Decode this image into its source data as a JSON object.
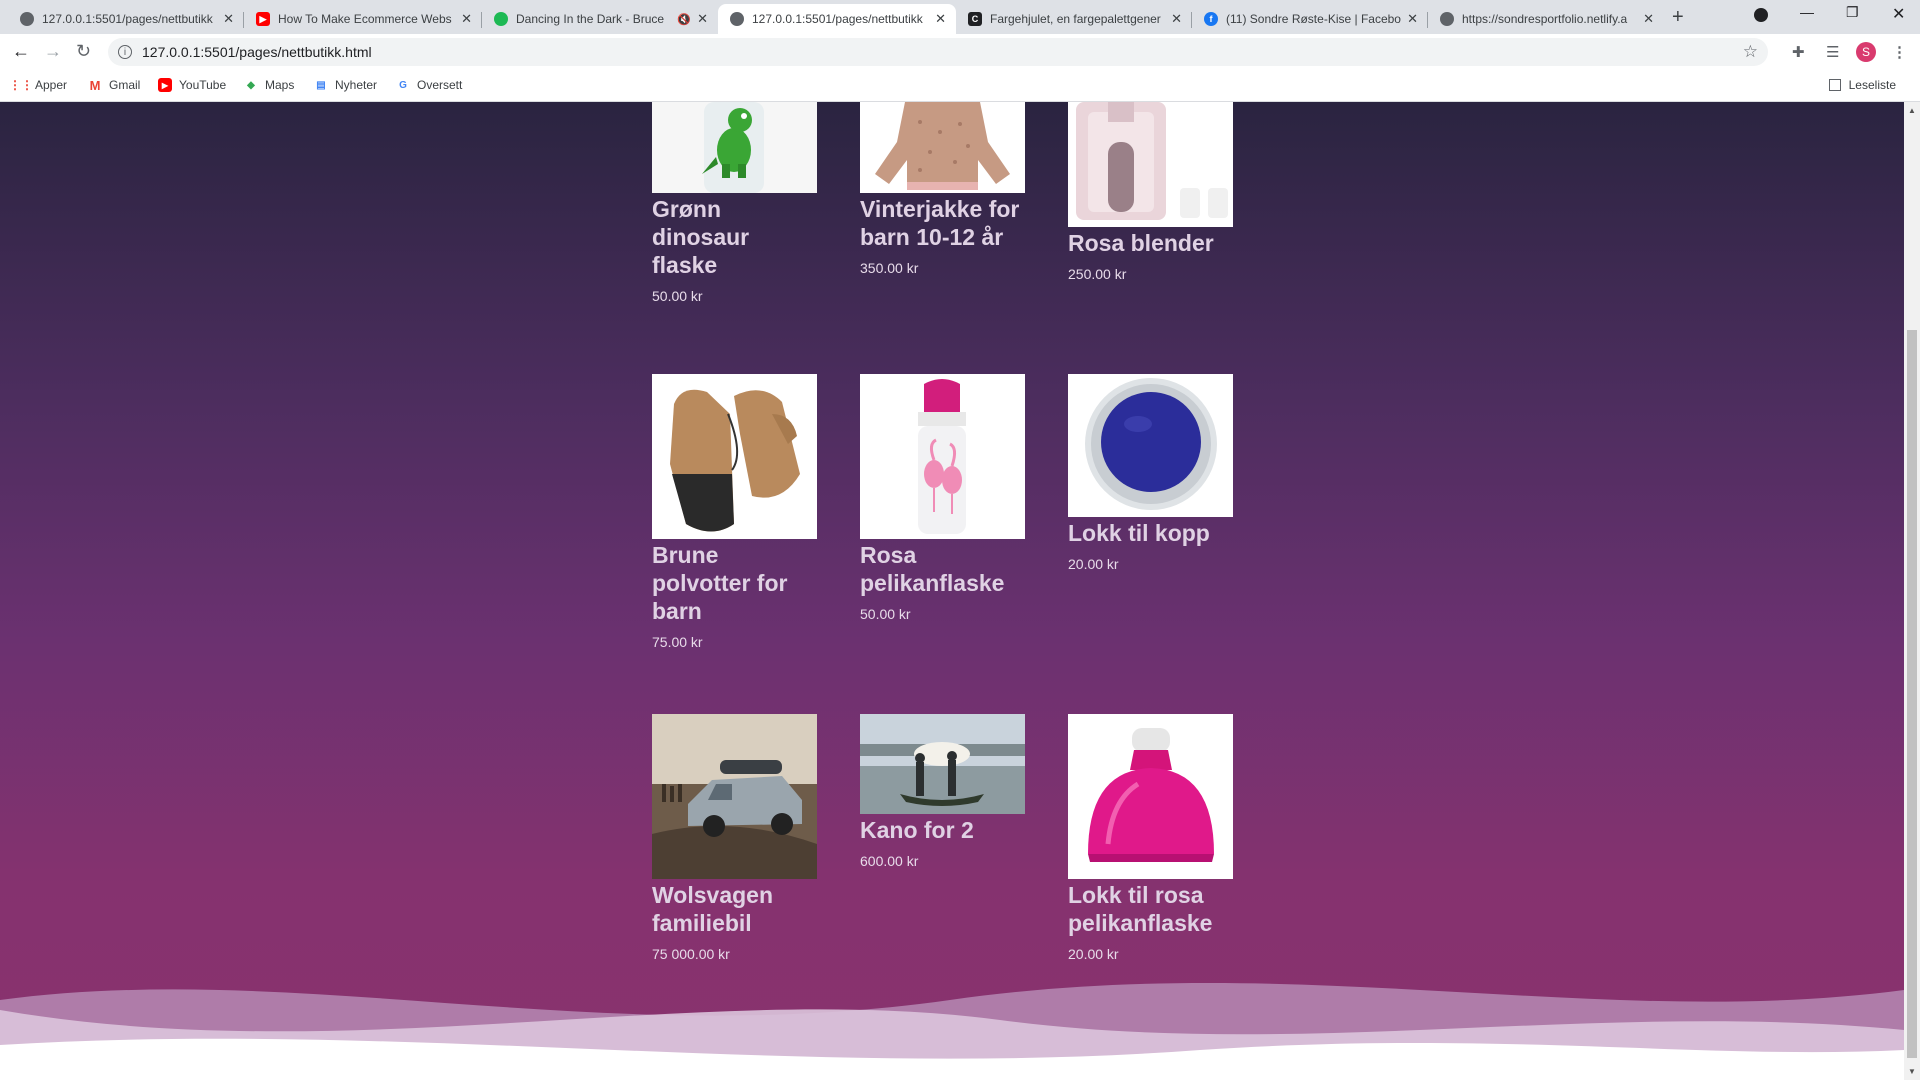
{
  "browser": {
    "tabs": [
      {
        "title": "127.0.0.1:5501/pages/nettbutikk",
        "icon": "globe-icon",
        "active": false
      },
      {
        "title": "How To Make Ecommerce Webs",
        "icon": "youtube-icon",
        "active": false
      },
      {
        "title": "Dancing In the Dark - Bruce",
        "icon": "spotify-icon",
        "active": false,
        "muted": true
      },
      {
        "title": "127.0.0.1:5501/pages/nettbutikk",
        "icon": "globe-icon",
        "active": true
      },
      {
        "title": "Fargehjulet, en fargepalettgener",
        "icon": "canva-icon",
        "active": false
      },
      {
        "title": "(11) Sondre Røste-Kise | Facebo",
        "icon": "facebook-icon",
        "active": false
      },
      {
        "title": "https://sondresportfolio.netlify.a",
        "icon": "globe-icon",
        "active": false
      }
    ],
    "url": "127.0.0.1:5501/pages/nettbutikk.html",
    "profile_initial": "S",
    "bookmarks": [
      {
        "label": "Apper",
        "icon": "apps-grid-icon"
      },
      {
        "label": "Gmail",
        "icon": "gmail-icon"
      },
      {
        "label": "YouTube",
        "icon": "youtube-icon"
      },
      {
        "label": "Maps",
        "icon": "maps-icon"
      },
      {
        "label": "Nyheter",
        "icon": "news-icon"
      },
      {
        "label": "Oversett",
        "icon": "translate-icon"
      }
    ],
    "reading_list": "Leseliste"
  },
  "products": [
    {
      "name": "Grønn dinosaur flaske",
      "price": "50.00 kr",
      "image": "green-dinosaur-bottle"
    },
    {
      "name": "Vinterjakke for barn 10-12 år",
      "price": "350.00 kr",
      "image": "winter-jacket"
    },
    {
      "name": "Rosa blender",
      "price": "250.00 kr",
      "image": "pink-blender"
    },
    {
      "name": "Brune polvotter for barn",
      "price": "75.00 kr",
      "image": "brown-mittens"
    },
    {
      "name": "Rosa pelikanflaske",
      "price": "50.00 kr",
      "image": "flamingo-bottle"
    },
    {
      "name": "Lokk til kopp",
      "price": "20.00 kr",
      "image": "cup-lid"
    },
    {
      "name": "Wolsvagen familiebil",
      "price": "75 000.00 kr",
      "image": "family-car"
    },
    {
      "name": "Kano for 2",
      "price": "600.00 kr",
      "image": "canoe"
    },
    {
      "name": "Lokk til rosa pelikanflaske",
      "price": "20.00 kr",
      "image": "pink-bottle-lid"
    }
  ]
}
